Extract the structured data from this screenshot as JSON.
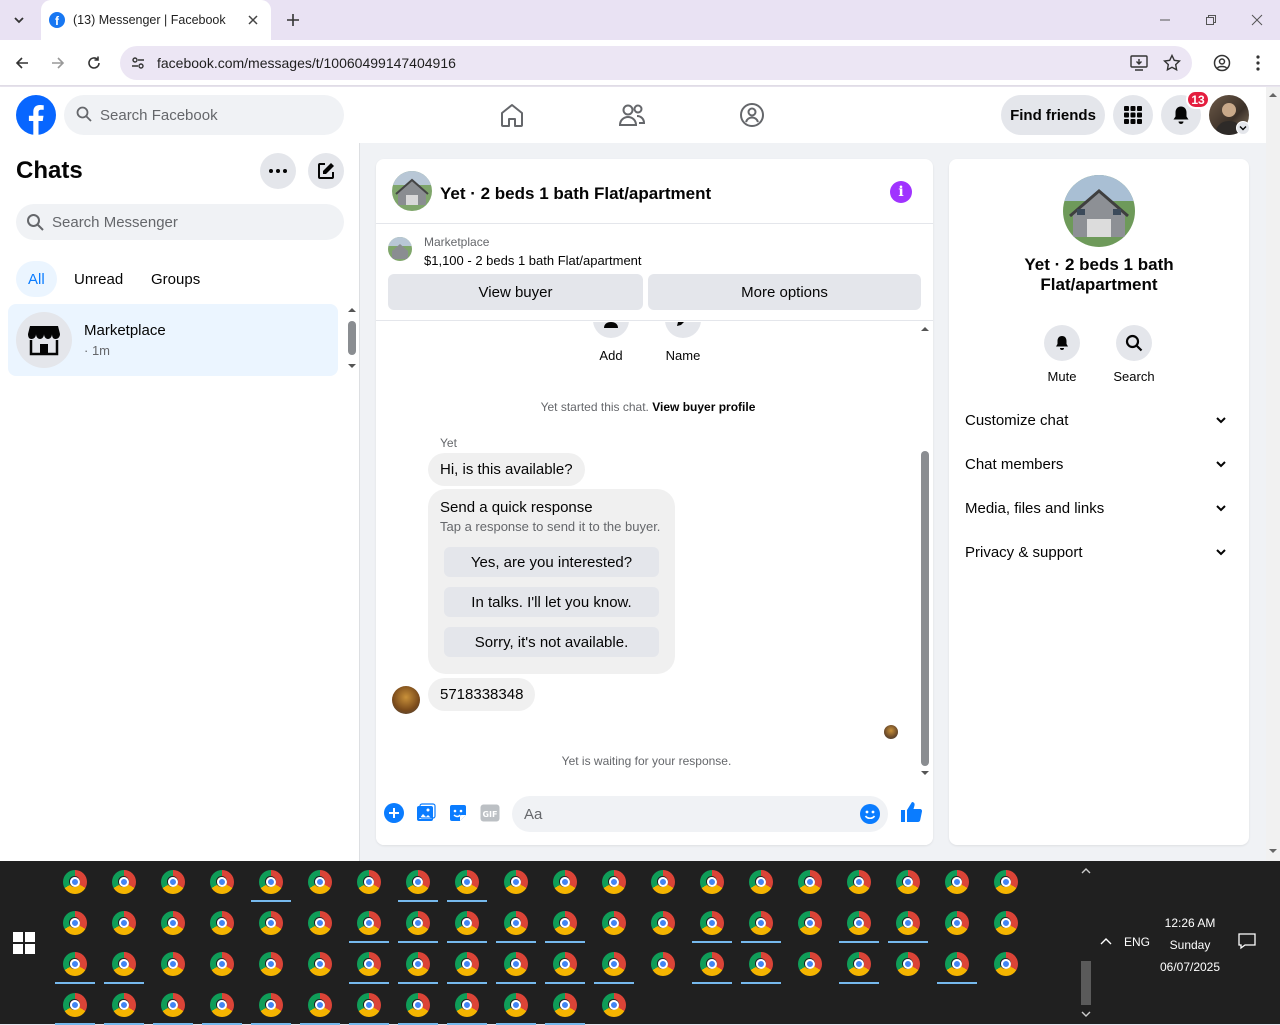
{
  "browser": {
    "tab_title": "(13) Messenger | Facebook",
    "favicon_letter": "f",
    "url": "facebook.com/messages/t/10060499147404916"
  },
  "facebook_header": {
    "search_placeholder": "Search Facebook",
    "find_friends_label": "Find friends",
    "notification_count": "13",
    "brand_color": "#1877f2"
  },
  "chats_panel": {
    "title": "Chats",
    "search_placeholder": "Search Messenger",
    "filters": [
      {
        "label": "All",
        "active": true
      },
      {
        "label": "Unread",
        "active": false
      },
      {
        "label": "Groups",
        "active": false
      }
    ],
    "threads": [
      {
        "name": "Marketplace",
        "meta": "· 1m",
        "icon": "marketplace-store-icon"
      }
    ]
  },
  "conversation": {
    "title": "Yet · 2 beds 1 bath Flat/apartment",
    "marketplace_label": "Marketplace",
    "listing": "$1,100 - 2 beds 1 bath Flat/apartment",
    "view_buyer_label": "View buyer",
    "more_options_label": "More options",
    "actions": [
      {
        "label": "Add",
        "icon": "person-add-icon"
      },
      {
        "label": "Name",
        "icon": "pencil-icon"
      }
    ],
    "started_text": "Yet started this chat.",
    "view_buyer_profile_label": "View buyer profile",
    "sender_name": "Yet",
    "first_message": "Hi, is this available?",
    "quick_response": {
      "heading": "Send a quick response",
      "subtext": "Tap a response to send it to the buyer.",
      "options": [
        "Yes, are you interested?",
        "In talks. I'll let you know.",
        "Sorry, it's not available."
      ]
    },
    "second_message": "5718338348",
    "waiting_text": "Yet is waiting for your response.",
    "composer_placeholder": "Aa",
    "accent_color": "#0a7cff"
  },
  "details_panel": {
    "title": "Yet · 2 beds 1 bath Flat/apartment",
    "actions": [
      {
        "label": "Mute",
        "icon": "bell-icon"
      },
      {
        "label": "Search",
        "icon": "search-icon"
      }
    ],
    "sections": [
      "Customize chat",
      "Chat members",
      "Media, files and links",
      "Privacy & support"
    ]
  },
  "taskbar": {
    "language": "ENG",
    "time": "12:26 AM",
    "day": "Sunday",
    "date": "06/07/2025"
  }
}
